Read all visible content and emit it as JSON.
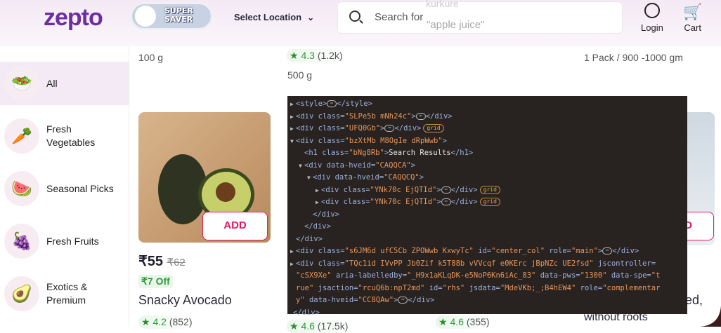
{
  "header": {
    "logo": "zepto",
    "super_saver": [
      "SUPER",
      "SAVER"
    ],
    "location": "Select Location",
    "search_prefix": "Search for",
    "search_rotating": "\"apple juice\"",
    "search_rotating_prev": "kurkure",
    "login": "Login",
    "cart": "Cart"
  },
  "sidebar": {
    "items": [
      {
        "label": "All",
        "icon": "🥗"
      },
      {
        "label": "Fresh Vegetables",
        "icon": "🥕"
      },
      {
        "label": "Seasonal Picks",
        "icon": "🍉"
      },
      {
        "label": "Fresh Fruits",
        "icon": "🍇"
      },
      {
        "label": "Exotics & Premium",
        "icon": "🥑"
      }
    ]
  },
  "products_top": {
    "col1_qty": "100 g",
    "col2_rating": "4.3",
    "col2_count": "(1.2k)",
    "col2_qty": "500 g",
    "col3_qty": "1 Pack / 900 -1000 gm"
  },
  "product": {
    "add": "ADD",
    "price": "₹55",
    "mrp": "₹62",
    "off": "₹7 Off",
    "name": "Snacky Avocado",
    "rating": "4.2",
    "count": "(852)"
  },
  "products_bottom": {
    "col2_rating": "4.6",
    "col2_count": "(17.5k)",
    "col3_rating": "4.6",
    "col3_count": "(355)",
    "col4_name_tail": "ed,",
    "col4_name_line2": "without roots",
    "col4_add": "D"
  },
  "colors": {
    "brand": "#6b2fa3",
    "add": "#e8175d",
    "rating": "#2e9b3e"
  },
  "devtools": {
    "lines": [
      {
        "i": 0,
        "a": "r",
        "k": [
          [
            "tg",
            "<style>"
          ],
          [
            "e",
            ""
          ],
          [
            "tg",
            "</style>"
          ]
        ]
      },
      {
        "i": 0,
        "a": "r",
        "k": [
          [
            "tg",
            "<div class="
          ],
          [
            "av",
            "\"SLPe5b mNh24c\""
          ],
          [
            "tg",
            ">"
          ],
          [
            "e",
            ""
          ],
          [
            "tg",
            "</div>"
          ]
        ]
      },
      {
        "i": 0,
        "a": "r",
        "k": [
          [
            "tg",
            "<div class="
          ],
          [
            "av",
            "\"UFQ0Gb\""
          ],
          [
            "tg",
            ">"
          ],
          [
            "e",
            ""
          ],
          [
            "tg",
            "</div>"
          ],
          [
            "b",
            "grid"
          ]
        ]
      },
      {
        "i": 0,
        "a": "d",
        "k": [
          [
            "tg",
            "<div class="
          ],
          [
            "av",
            "\"bzXtMb M8OgIe dRpWwb\""
          ],
          [
            "tg",
            ">"
          ]
        ]
      },
      {
        "i": 1,
        "a": "",
        "k": [
          [
            "tg",
            "<h1 class="
          ],
          [
            "av",
            "\"bNg8Rb\""
          ],
          [
            "tg",
            ">"
          ],
          [
            "tx",
            "Search Results"
          ],
          [
            "tg",
            "</h1>"
          ]
        ]
      },
      {
        "i": 1,
        "a": "d",
        "k": [
          [
            "tg",
            "<div data-hveid="
          ],
          [
            "av",
            "\"CAQQCA\""
          ],
          [
            "tg",
            ">"
          ]
        ]
      },
      {
        "i": 2,
        "a": "d",
        "k": [
          [
            "tg",
            "<div data-hveid="
          ],
          [
            "av",
            "\"CAQQCQ\""
          ],
          [
            "tg",
            ">"
          ]
        ]
      },
      {
        "i": 3,
        "a": "r",
        "k": [
          [
            "tg",
            "<div class="
          ],
          [
            "av",
            "\"YNk70c EjQTId\""
          ],
          [
            "tg",
            ">"
          ],
          [
            "e",
            ""
          ],
          [
            "tg",
            "</div>"
          ],
          [
            "b",
            "grid"
          ]
        ]
      },
      {
        "i": 3,
        "a": "r",
        "k": [
          [
            "tg",
            "<div class="
          ],
          [
            "av",
            "\"YNk70c EjQTId\""
          ],
          [
            "tg",
            ">"
          ],
          [
            "e",
            ""
          ],
          [
            "tg",
            "</div>"
          ],
          [
            "b",
            "grid"
          ]
        ]
      },
      {
        "i": 2,
        "a": "",
        "k": [
          [
            "tg",
            "</div>"
          ]
        ]
      },
      {
        "i": 1,
        "a": "",
        "k": [
          [
            "tg",
            "</div>"
          ]
        ]
      },
      {
        "i": 0,
        "a": "",
        "k": [
          [
            "tg",
            "</div>"
          ]
        ]
      },
      {
        "i": 0,
        "a": "r",
        "k": [
          [
            "tg",
            "<div class="
          ],
          [
            "av",
            "\"s6JM6d ufC5Cb ZPOWwb KxwyTc\""
          ],
          [
            "tg",
            " id="
          ],
          [
            "av",
            "\"center_col\""
          ],
          [
            "tg",
            " role="
          ],
          [
            "av",
            "\"main\""
          ],
          [
            "tg",
            ">"
          ],
          [
            "e",
            ""
          ],
          [
            "tg",
            "</div>"
          ]
        ]
      },
      {
        "i": 0,
        "a": "r",
        "k": [
          [
            "tg",
            "<div class="
          ],
          [
            "av",
            "\"TQc1id IVvPP Jb0Zif k5T88b vVVcqf e0KErc jBpNZc UE2fsd\""
          ],
          [
            "tg",
            " jscontroller="
          ]
        ]
      },
      {
        "i": 0,
        "a": "",
        "k": [
          [
            "av",
            "\"cSX9Xe\""
          ],
          [
            "tg",
            " aria-labelledby="
          ],
          [
            "av",
            "\"_H9x1aKLqDK-e5NoP6Kn6iAc_83\""
          ],
          [
            "tg",
            " data-pws="
          ],
          [
            "av",
            "\"1300\""
          ],
          [
            "tg",
            " data-spe="
          ],
          [
            "av",
            "\"t"
          ]
        ]
      },
      {
        "i": 0,
        "a": "",
        "k": [
          [
            "av",
            "rue\""
          ],
          [
            "tg",
            " jsaction="
          ],
          [
            "av",
            "\"rcuQ6b:npT2md\""
          ],
          [
            "tg",
            " id="
          ],
          [
            "av",
            "\"rhs\""
          ],
          [
            "tg",
            " jsdata="
          ],
          [
            "av",
            "\"MdeVKb;_;B4hEW4\""
          ],
          [
            "tg",
            " role="
          ],
          [
            "av",
            "\"complementar"
          ]
        ]
      },
      {
        "i": 0,
        "a": "",
        "k": [
          [
            "av",
            "y\""
          ],
          [
            "tg",
            " data-hveid="
          ],
          [
            "av",
            "\"CC8QAw\""
          ],
          [
            "tg",
            ">"
          ],
          [
            "e",
            ""
          ],
          [
            "tg",
            "</div>"
          ]
        ]
      },
      {
        "i": -1,
        "a": "",
        "k": [
          [
            "tg",
            "</div>"
          ]
        ]
      }
    ]
  }
}
